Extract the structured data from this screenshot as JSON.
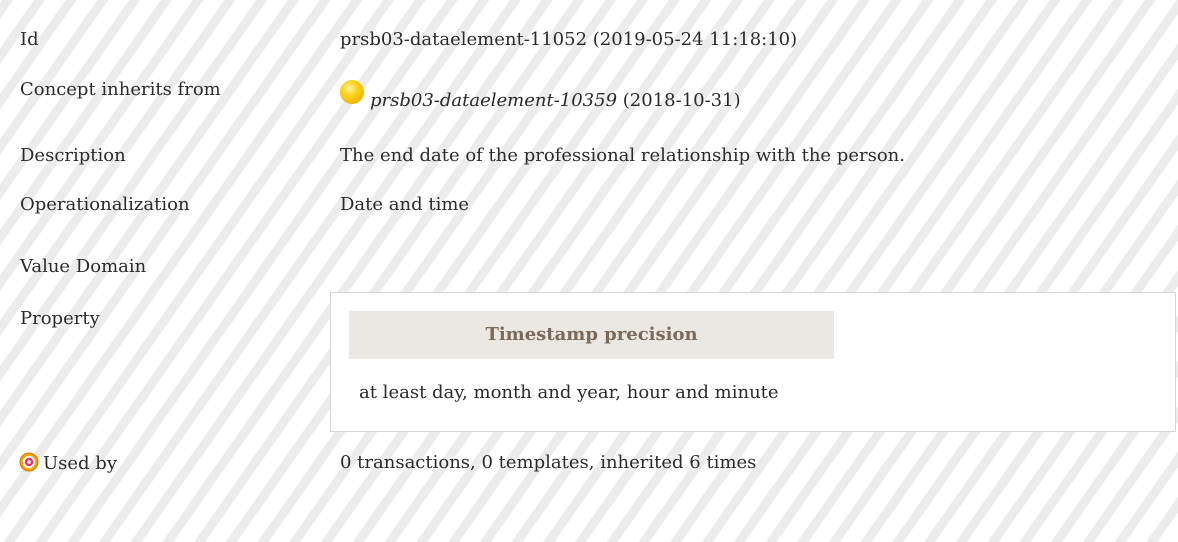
{
  "rows": {
    "id": {
      "label": "Id",
      "value": "prsb03-dataelement-11052 (2019-05-24 11:18:10)"
    },
    "inherits": {
      "label": "Concept inherits from",
      "ref_id": "prsb03-dataelement-10359",
      "ref_date": "(2018-10-31)",
      "status_icon": "yellow-status-ball-icon",
      "status_color": "#ffd21a"
    },
    "description": {
      "label": "Description",
      "value": "The end date of the professional relationship with the person."
    },
    "operationalization": {
      "label": "Operationalization",
      "value": "Date and time"
    },
    "value_domain": {
      "label": "Value Domain"
    },
    "property": {
      "label": "Property",
      "header": "Timestamp precision",
      "value": "at least day, month and year, hour and minute",
      "header_bg": "#ebe7e3",
      "header_color": "#7a6a5c"
    },
    "used_by": {
      "label": "Used by",
      "icon": "target-icon",
      "icon_color": "#e8a000",
      "value": "0 transactions, 0 templates, inherited 6 times"
    }
  }
}
